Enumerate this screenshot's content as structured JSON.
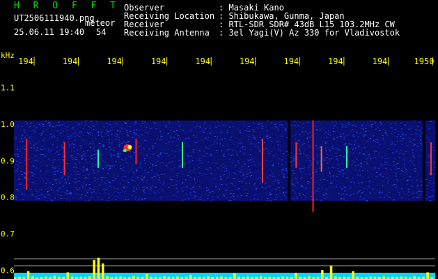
{
  "header": {
    "app_name": "H R O F F T",
    "filename": "UT2506111940.png",
    "type_label": "meteor",
    "datetime": "25.06.11 19:40",
    "count": "54",
    "fields": [
      {
        "label": "Observer",
        "value": ": Masaki Kano"
      },
      {
        "label": "Receiving Location",
        "value": ": Shibukawa, Gunma, Japan"
      },
      {
        "label": "Receiver",
        "value": ": RTL-SDR SDR# 43dB L15 103.2MHz CW"
      },
      {
        "label": "Receiving Antenna",
        "value": ": 3el Yagi(V) Az 330 for Vladivostok"
      }
    ]
  },
  "chart_data": {
    "type": "heatmap",
    "ylabel": "kHz",
    "y_ticks": [
      "1.1",
      "1.0",
      "0.9",
      "0.8",
      "0.7",
      "0.6"
    ],
    "y_tick_values": [
      1.1,
      1.0,
      0.9,
      0.8,
      0.7,
      0.6
    ],
    "x_ticks": [
      "194",
      "194",
      "194",
      "194",
      "194",
      "194",
      "194",
      "194",
      "194",
      "1950"
    ],
    "ylim": [
      0.58,
      1.16
    ],
    "noise_band_khz": [
      0.79,
      1.01
    ],
    "meteor_echoes": [
      {
        "t": 0.03,
        "f0": 0.82,
        "f1": 0.96,
        "color": "#ff2020"
      },
      {
        "t": 0.12,
        "f0": 0.86,
        "f1": 0.95,
        "color": "#ff3030"
      },
      {
        "t": 0.2,
        "f0": 0.88,
        "f1": 0.93,
        "color": "#20ffa0"
      },
      {
        "t": 0.29,
        "f0": 0.89,
        "f1": 0.96,
        "color": "#ff2020"
      },
      {
        "t": 0.4,
        "f0": 0.88,
        "f1": 0.95,
        "color": "#40ff80"
      },
      {
        "t": 0.59,
        "f0": 0.84,
        "f1": 0.96,
        "color": "#ff4040"
      },
      {
        "t": 0.67,
        "f0": 0.88,
        "f1": 0.95,
        "color": "#ff3030"
      },
      {
        "t": 0.71,
        "f0": 0.76,
        "f1": 1.01,
        "color": "#ff2020"
      },
      {
        "t": 0.73,
        "f0": 0.87,
        "f1": 0.94,
        "color": "#ff6040"
      },
      {
        "t": 0.79,
        "f0": 0.88,
        "f1": 0.94,
        "color": "#30ffb0"
      },
      {
        "t": 0.99,
        "f0": 0.86,
        "f1": 0.95,
        "color": "#ff3030"
      }
    ],
    "intensity_bars": [
      0.08,
      0.1,
      0.09,
      0.35,
      0.12,
      0.07,
      0.09,
      0.11,
      0.08,
      0.14,
      0.1,
      0.09,
      0.3,
      0.11,
      0.08,
      0.1,
      0.09,
      0.12,
      0.85,
      0.95,
      0.7,
      0.12,
      0.09,
      0.1,
      0.11,
      0.08,
      0.09,
      0.13,
      0.1,
      0.09,
      0.22,
      0.1,
      0.08,
      0.09,
      0.12,
      0.1,
      0.08,
      0.11,
      0.09,
      0.1,
      0.18,
      0.09,
      0.1,
      0.08,
      0.12,
      0.09,
      0.1,
      0.11,
      0.08,
      0.09,
      0.25,
      0.1,
      0.09,
      0.11,
      0.08,
      0.1,
      0.12,
      0.09,
      0.1,
      0.08,
      0.09,
      0.11,
      0.1,
      0.09,
      0.28,
      0.1,
      0.09,
      0.12,
      0.08,
      0.1,
      0.4,
      0.09,
      0.6,
      0.11,
      0.08,
      0.1,
      0.09,
      0.35,
      0.1,
      0.08,
      0.09,
      0.11,
      0.1,
      0.09,
      0.12,
      0.08,
      0.1,
      0.09,
      0.11,
      0.1,
      0.08,
      0.12,
      0.09,
      0.1,
      0.3,
      0.09
    ]
  }
}
